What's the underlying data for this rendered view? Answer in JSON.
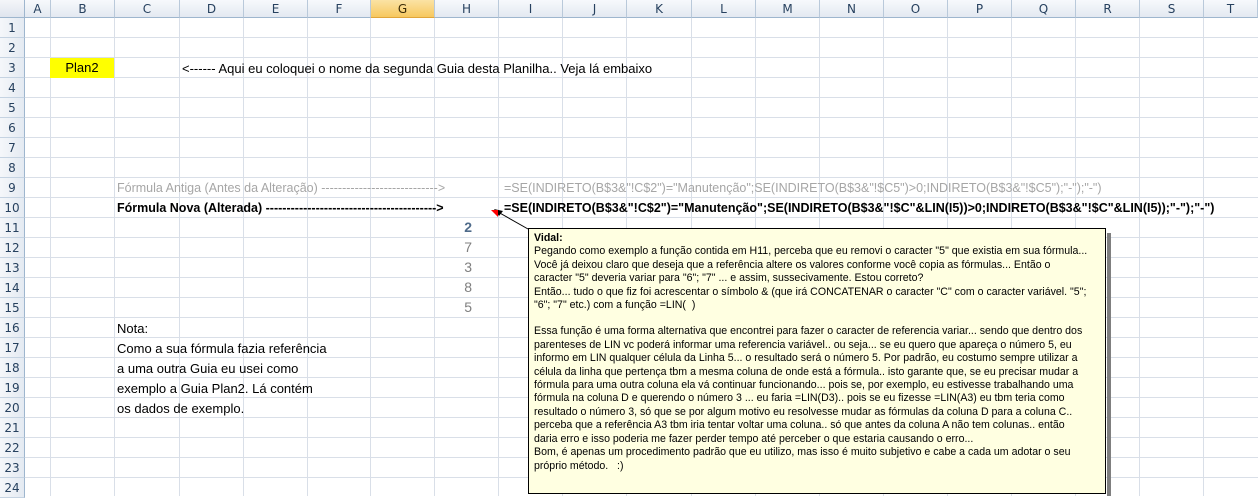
{
  "columns": [
    "A",
    "B",
    "C",
    "D",
    "E",
    "F",
    "G",
    "H",
    "I",
    "J",
    "K",
    "L",
    "M",
    "N",
    "O",
    "P",
    "Q",
    "R",
    "S",
    "T"
  ],
  "selected_column": "G",
  "rows": [
    "1",
    "2",
    "3",
    "4",
    "5",
    "6",
    "7",
    "8",
    "9",
    "10",
    "11",
    "12",
    "13",
    "14",
    "15",
    "16",
    "17",
    "18",
    "19",
    "20",
    "21",
    "22",
    "23",
    "24"
  ],
  "cells": {
    "b3": "Plan2",
    "c3": "<------ Aqui eu coloquei o nome da segunda Guia desta Planilha.. Veja lá embaixo",
    "c9": "Fórmula Antiga (Antes da Alteração)  ---------------------------->",
    "i9": "=SE(INDIRETO(B$3&\"!C$2\")=\"Manutenção\";SE(INDIRETO(B$3&\"!$C5\")>0;INDIRETO(B$3&\"!$C5\");\"-\");\"-\")",
    "c10": "Fórmula Nova (Alterada) ----------------------------------------->",
    "i10": "=SE(INDIRETO(B$3&\"!C$2\")=\"Manutenção\";SE(INDIRETO(B$3&\"!$C\"&LIN(I5))>0;INDIRETO(B$3&\"!$C\"&LIN(I5));\"-\");\"-\")",
    "h11": "2",
    "h12": "7",
    "h13": "3",
    "h14": "8",
    "h15": "5",
    "c16": "Nota:",
    "c17": "Como a sua fórmula fazia referência",
    "c18": "a uma outra Guia eu usei como",
    "c19": "exemplo a Guia Plan2. Lá contém",
    "c20": "os dados de exemplo."
  },
  "comment": {
    "author": "Vidal:",
    "lines": [
      "Pegando como exemplo a função contida em H11, perceba que eu removi o caracter \"5\" que existia em sua fórmula...",
      "Você já deixou claro que deseja que a referência altere os valores conforme você copia as fórmulas... Então o",
      "caracter \"5\" deveria variar para \"6\"; \"7\" ... e assim, sussecivamente. Estou correto?",
      "Então... tudo o que fiz foi acrescentar o símbolo & (que irá CONCATENAR o caracter \"C\" com o caracter variável. \"5\";",
      "\"6\"; \"7\" etc.) com a função =LIN(  )",
      "",
      "Essa função é uma forma alternativa que encontrei para fazer o caracter de referencia variar... sendo que dentro dos",
      "parenteses de LIN vc poderá informar uma referencia variável.. ou seja... se eu quero que apareça o número 5, eu",
      "informo em LIN qualquer célula da Linha 5... o resultado será o número 5. Por padrão, eu costumo sempre utilizar a",
      "célula da linha que pertença tbm a mesma coluna de onde está a fórmula.. isto garante que, se eu precisar mudar a",
      "fórmula para uma outra coluna ela vá continuar funcionando... pois se, por exemplo, eu estivesse trabalhando uma",
      "fórmula na coluna D e querendo o número 3 ... eu faria =LIN(D3).. pois se eu fizesse =LIN(A3) eu tbm teria como",
      "resultado o número 3, só que se por algum motivo eu resolvesse mudar as fórmulas da coluna D para a coluna C..",
      "perceba que a referência A3 tbm iria tentar voltar uma coluna.. só que antes da coluna A não tem colunas.. então",
      "daria erro e isso poderia me fazer perder tempo até perceber o que estaria causando o erro...",
      "Bom, é apenas um procedimento padrão que eu utilizo, mas isso é muito subjetivo e cabe a cada um adotar o seu",
      "próprio método.   :)"
    ]
  },
  "colors": {
    "highlight": "#ffff00",
    "comment_bg": "#ffffe1",
    "grid": "#d9dfe8",
    "header_selected": "#f7c85f"
  }
}
